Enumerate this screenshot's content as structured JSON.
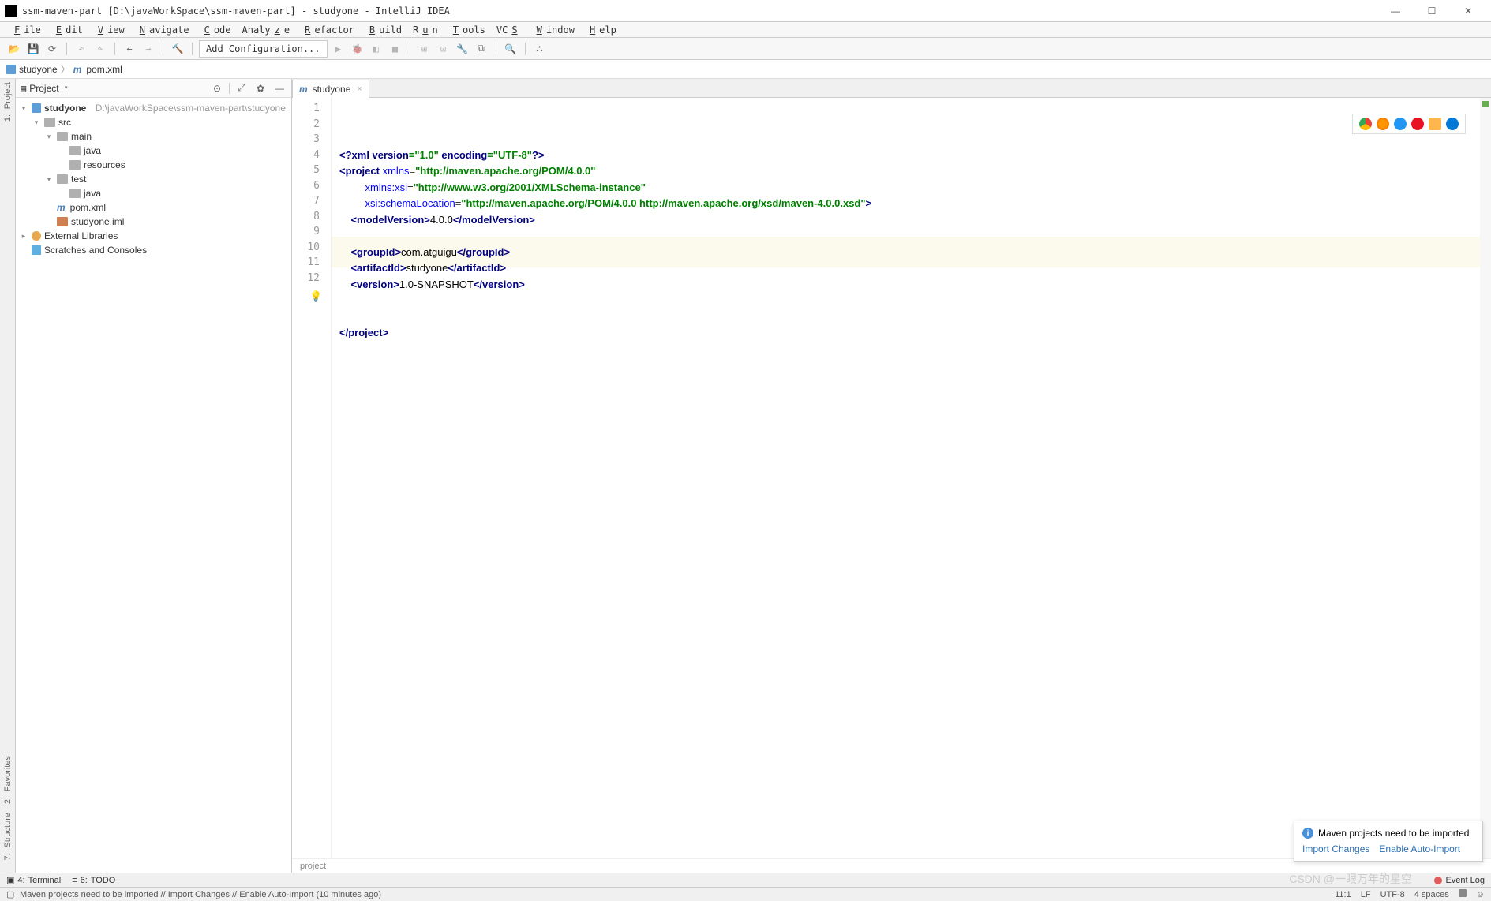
{
  "titlebar": {
    "title": "ssm-maven-part [D:\\javaWorkSpace\\ssm-maven-part] - studyone - IntelliJ IDEA"
  },
  "menubar": {
    "items": [
      "File",
      "Edit",
      "View",
      "Navigate",
      "Code",
      "Analyze",
      "Refactor",
      "Build",
      "Run",
      "Tools",
      "VCS",
      "Window",
      "Help"
    ]
  },
  "toolbar": {
    "configuration": "Add Configuration..."
  },
  "navbar": {
    "crumb1": "studyone",
    "crumb2": "pom.xml"
  },
  "project_panel": {
    "label": "Project",
    "tree": {
      "root": "studyone",
      "rootpath": "D:\\javaWorkSpace\\ssm-maven-part\\studyone",
      "src": "src",
      "main": "main",
      "main_java": "java",
      "main_resources": "resources",
      "test": "test",
      "test_java": "java",
      "pom": "pom.xml",
      "iml": "studyone.iml",
      "ext": "External Libraries",
      "scratch": "Scratches and Consoles"
    }
  },
  "editor": {
    "tab": "studyone",
    "linecount": 12,
    "breadcrumb": "project",
    "code": {
      "l1_a": "<?",
      "l1_b": "xml version",
      "l1_c": "=\"1.0\" ",
      "l1_d": "encoding",
      "l1_e": "=\"UTF-8\"",
      "l1_f": "?>",
      "l2_a": "<",
      "l2_b": "project ",
      "l2_c": "xmlns",
      "l2_d": "=",
      "l2_e": "\"http://maven.apache.org/POM/4.0.0\"",
      "l3_a": "         ",
      "l3_b": "xmlns:xsi",
      "l3_c": "=",
      "l3_d": "\"http://www.w3.org/2001/XMLSchema-instance\"",
      "l4_a": "         ",
      "l4_b": "xsi:schemaLocation",
      "l4_c": "=",
      "l4_d": "\"http://maven.apache.org/POM/4.0.0 http://maven.apache.org/xsd/maven-4.0.0.xsd\"",
      "l4_e": ">",
      "l5_a": "    <",
      "l5_b": "modelVersion",
      "l5_c": ">",
      "l5_d": "4.0.0",
      "l5_e": "</",
      "l5_f": "modelVersion",
      "l5_g": ">",
      "l7_a": "    <",
      "l7_b": "groupId",
      "l7_c": ">",
      "l7_d": "com.atguigu",
      "l7_e": "</",
      "l7_f": "groupId",
      "l7_g": ">",
      "l8_a": "    <",
      "l8_b": "artifactId",
      "l8_c": ">",
      "l8_d": "studyone",
      "l8_e": "</",
      "l8_f": "artifactId",
      "l8_g": ">",
      "l9_a": "    <",
      "l9_b": "version",
      "l9_c": ">",
      "l9_d": "1.0-SNAPSHOT",
      "l9_e": "</",
      "l9_f": "version",
      "l9_g": ">",
      "l12_a": "</",
      "l12_b": "project",
      "l12_c": ">"
    }
  },
  "notification": {
    "title": "Maven projects need to be imported",
    "link1": "Import Changes",
    "link2": "Enable Auto-Import"
  },
  "bottom_tabs": {
    "terminal": "Terminal",
    "terminal_n": "4:",
    "todo": "TODO",
    "todo_n": "6:",
    "eventlog": "Event Log"
  },
  "statusbar": {
    "msg": "Maven projects need to be imported // Import Changes // Enable Auto-Import (10 minutes ago)",
    "pos": "11:1",
    "lf": "LF",
    "enc": "UTF-8",
    "indent": "4 spaces"
  },
  "sidebar": {
    "project_n": "1:",
    "project": "Project",
    "structure_n": "7:",
    "structure": "Structure",
    "favorites_n": "2:",
    "favorites": "Favorites"
  },
  "watermark": "CSDN @一眼万年的星空"
}
